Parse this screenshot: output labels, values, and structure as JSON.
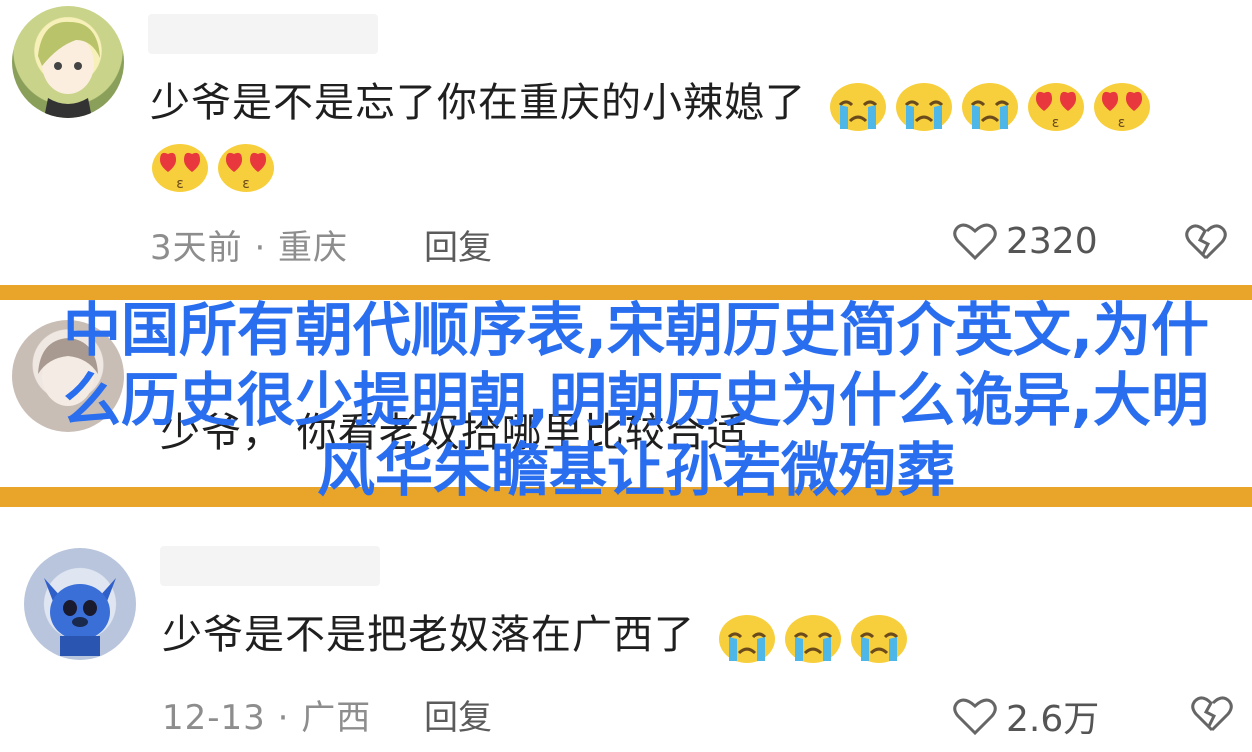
{
  "comments": [
    {
      "text": "少爷是不是忘了你在重庆的小辣媳了",
      "emojis_line1": [
        "crying-face",
        "crying-face",
        "crying-face",
        "heart-eyes-face",
        "heart-eyes-face"
      ],
      "emojis_line2": [
        "heart-eyes-face",
        "heart-eyes-face"
      ],
      "meta": "3天前 · 重庆",
      "reply": "回复",
      "likes": "2320"
    },
    {
      "text": "少爷，  你看老奴拾哪里比较合适"
    },
    {
      "text": "少爷是不是把老奴落在广西了",
      "emojis_line1": [
        "crying-face",
        "crying-face",
        "crying-face"
      ],
      "meta": "12-13 · 广西",
      "reply": "回复",
      "likes": "2.6万"
    }
  ],
  "headline": "中国所有朝代顺序表,宋朝历史简介英文,为什么历史很少提明朝,明朝历史为什么诡异,大明风华朱瞻基让孙若微殉葬",
  "colors": {
    "accent_stripe": "#e9a52a",
    "headline": "#2a6ef0",
    "meta": "#8d8d8d"
  }
}
